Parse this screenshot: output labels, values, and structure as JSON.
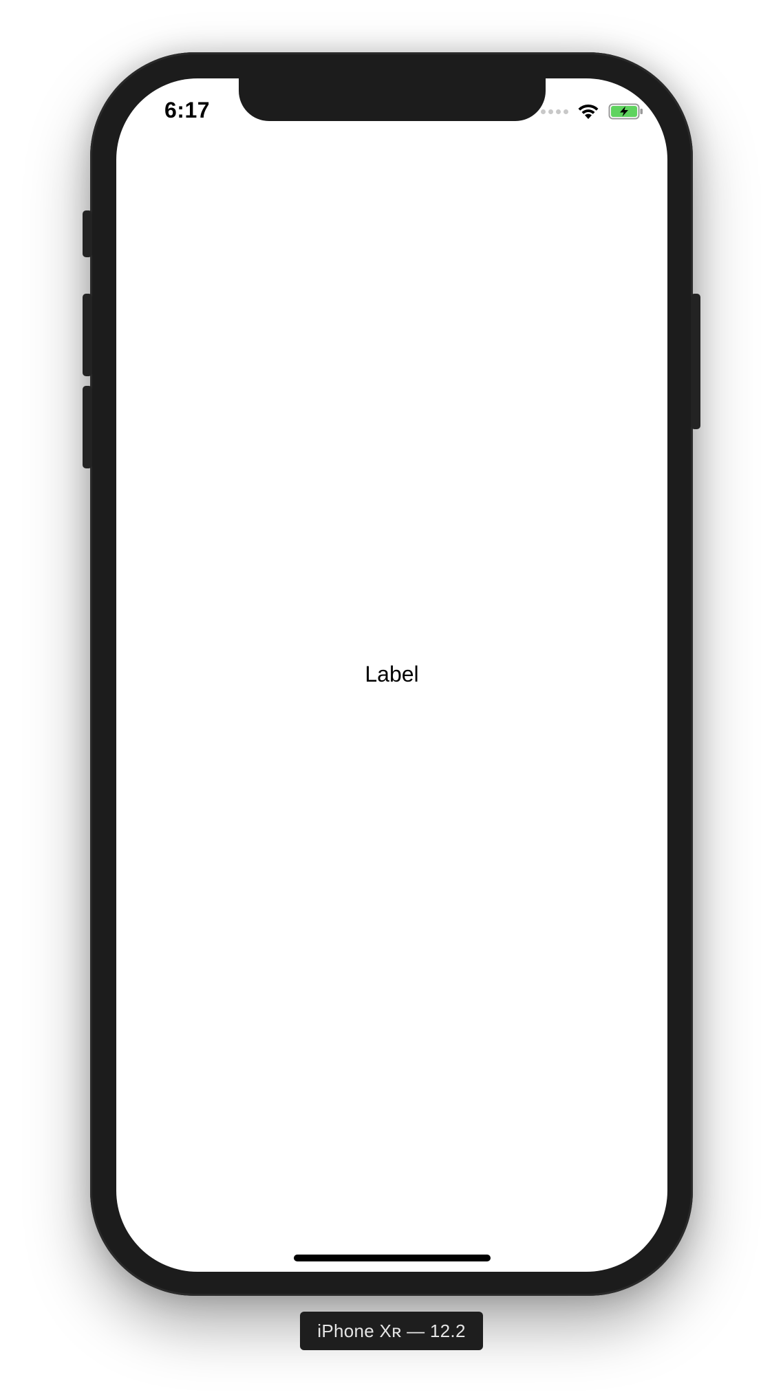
{
  "status_bar": {
    "time": "6:17",
    "signal_icon": "signal-dots-icon",
    "wifi_icon": "wifi-icon",
    "battery_icon": "battery-charging-icon",
    "battery_color": "#5fd35f"
  },
  "content": {
    "label": "Label"
  },
  "simulator": {
    "device_caption": "iPhone Xʀ — 12.2"
  },
  "colors": {
    "frame": "#1c1c1c",
    "screen": "#ffffff",
    "caption_bg": "#1e1e1e"
  }
}
